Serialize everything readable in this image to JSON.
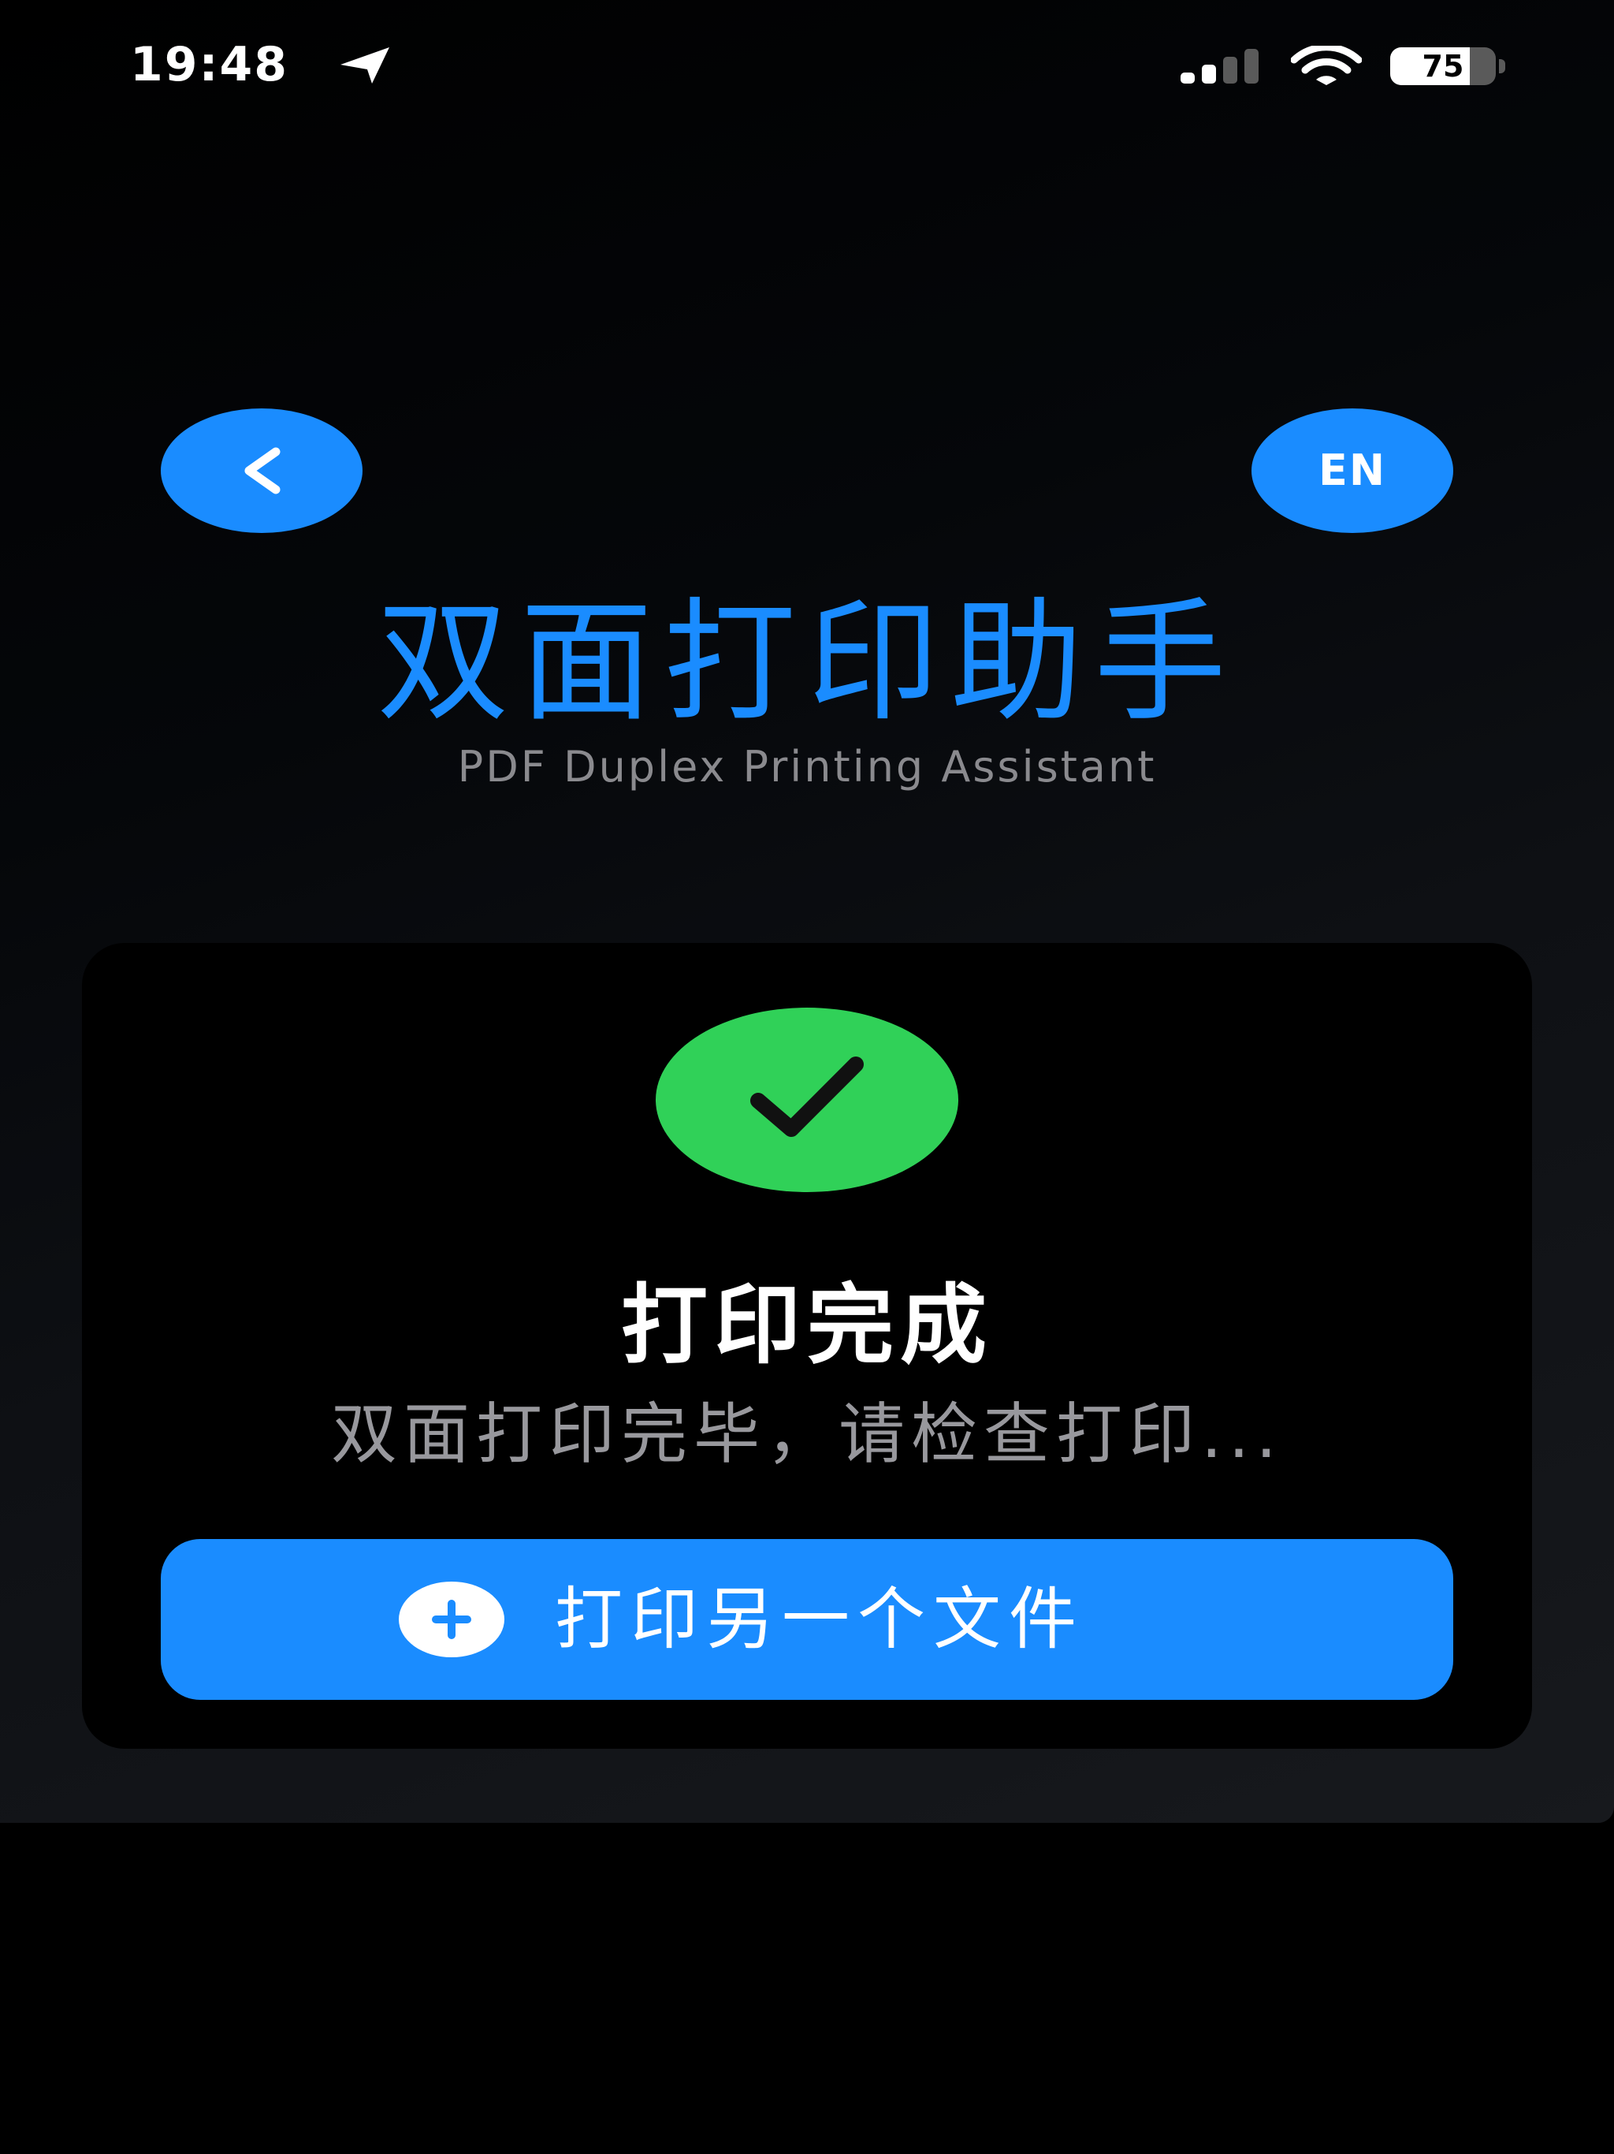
{
  "status_bar": {
    "time": "19:48",
    "battery_level": "75",
    "battery_fraction": 0.75,
    "signal_bars_active": 2,
    "signal_bars_total": 4,
    "icons": [
      "location-arrow-icon",
      "cellular-signal-icon",
      "wifi-icon",
      "battery-icon"
    ]
  },
  "nav": {
    "back_icon": "chevron-left-icon",
    "language_label": "EN"
  },
  "header": {
    "title": "双面打印助手",
    "subtitle": "PDF Duplex Printing Assistant"
  },
  "result": {
    "icon": "checkmark-icon",
    "title": "打印完成",
    "message": "双面打印完毕，请检查打印...",
    "action_icon": "plus-circle-icon",
    "action_label": "打印另一个文件"
  },
  "colors": {
    "accent": "#1a8cff",
    "success": "#30d158",
    "background": "#000000",
    "subtitle_text": "#8a8a8e",
    "message_text": "#98989d"
  }
}
